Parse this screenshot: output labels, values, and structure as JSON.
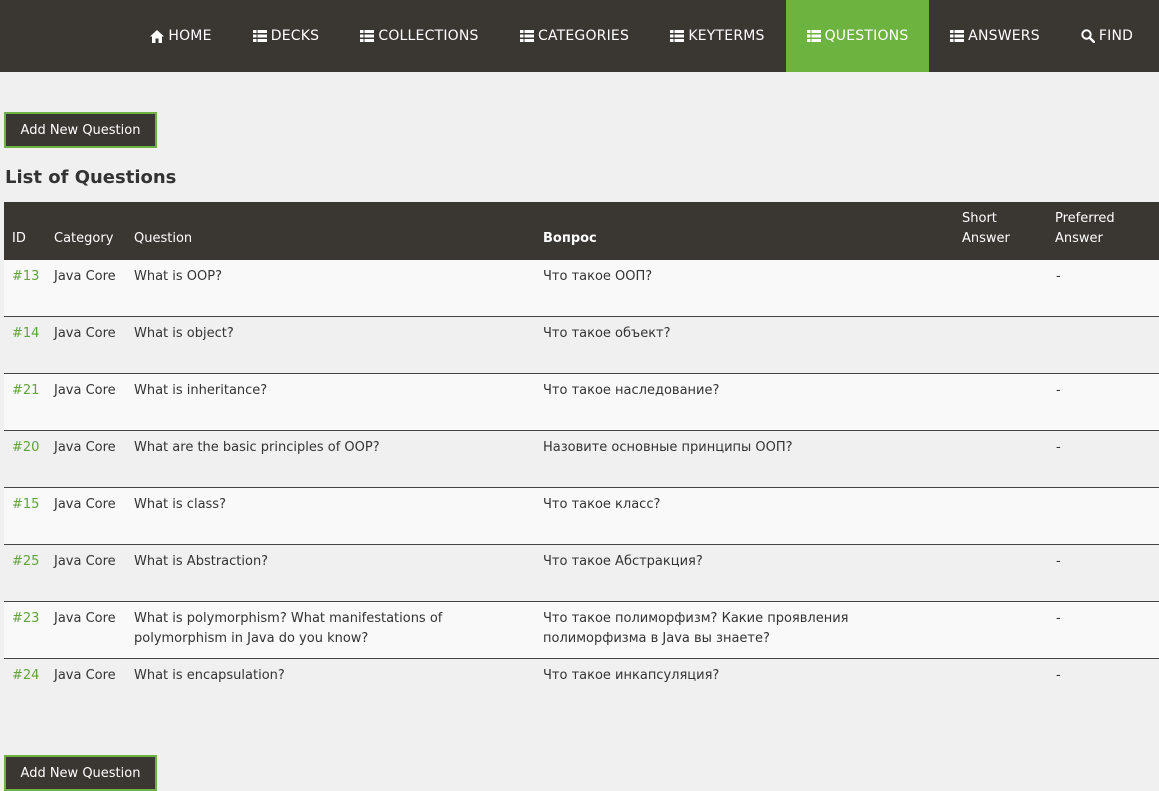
{
  "nav": [
    {
      "label": "HOME",
      "icon": "home-icon",
      "active": false
    },
    {
      "label": "DECKS",
      "icon": "list-icon",
      "active": false
    },
    {
      "label": "COLLECTIONS",
      "icon": "list-icon",
      "active": false
    },
    {
      "label": "CATEGORIES",
      "icon": "list-icon",
      "active": false
    },
    {
      "label": "KEYTERMS",
      "icon": "list-icon",
      "active": false
    },
    {
      "label": "QUESTIONS",
      "icon": "list-icon",
      "active": true
    },
    {
      "label": "ANSWERS",
      "icon": "list-icon",
      "active": false
    },
    {
      "label": "FIND",
      "icon": "search-icon",
      "active": false
    }
  ],
  "add_button_label": "Add New Question",
  "list_title": "List of Questions",
  "table": {
    "headers": {
      "id": "ID",
      "category": "Category",
      "question": "Question",
      "question_ru": "Вопрос",
      "short_answer": "Short Answer",
      "preferred_answer": "Preferred Answer"
    },
    "rows": [
      {
        "id": "#13",
        "category": "Java Core",
        "question": "What is OOP?",
        "question_ru": "Что такое ООП?",
        "short_answer": "",
        "preferred_answer": "-"
      },
      {
        "id": "#14",
        "category": "Java Core",
        "question": "What is object?",
        "question_ru": "Что такое объект?",
        "short_answer": "",
        "preferred_answer": ""
      },
      {
        "id": "#21",
        "category": "Java Core",
        "question": "What is inheritance?",
        "question_ru": "Что такое наследование?",
        "short_answer": "",
        "preferred_answer": "-"
      },
      {
        "id": "#20",
        "category": "Java Core",
        "question": "What are the basic principles of OOP?",
        "question_ru": "Назовите основные принципы ООП?",
        "short_answer": "",
        "preferred_answer": "-"
      },
      {
        "id": "#15",
        "category": "Java Core",
        "question": "What is class?",
        "question_ru": "Что такое класс?",
        "short_answer": "",
        "preferred_answer": ""
      },
      {
        "id": "#25",
        "category": "Java Core",
        "question": "What is Abstraction?",
        "question_ru": "Что такое Абстракция?",
        "short_answer": "",
        "preferred_answer": "-"
      },
      {
        "id": "#23",
        "category": "Java Core",
        "question": "What is polymorphism? What manifestations of polymorphism in Java do you know?",
        "question_ru": "Что такое полиморфизм? Какие проявления полиморфизма в Java вы знаете?",
        "short_answer": "",
        "preferred_answer": "-"
      },
      {
        "id": "#24",
        "category": "Java Core",
        "question": "What is encapsulation?",
        "question_ru": "Что такое инкапсуляция?",
        "short_answer": "",
        "preferred_answer": "-"
      }
    ]
  },
  "colors": {
    "nav_bg": "#3a3632",
    "accent": "#6db33f",
    "id_link": "#5fa33a",
    "page_bg": "#f0f0f0"
  }
}
